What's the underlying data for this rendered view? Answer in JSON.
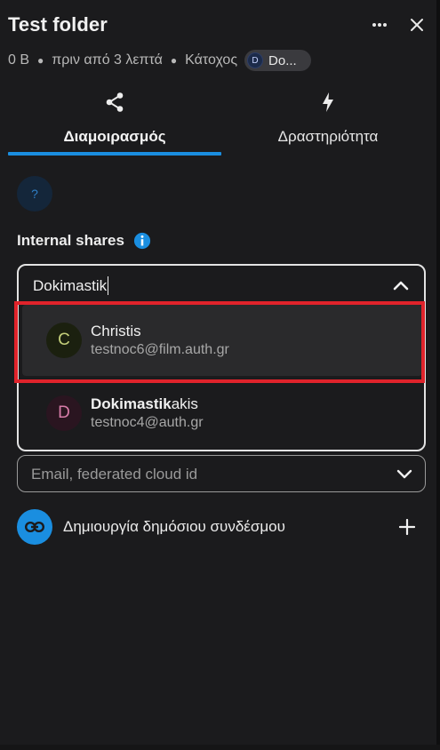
{
  "header": {
    "title": "Test folder",
    "size": "0 B",
    "modified": "πριν από 3 λεπτά",
    "owner_label": "Κάτοχος",
    "owner_initial": "D",
    "owner_name": "Do..."
  },
  "tabs": [
    {
      "label": "Διαμοιρασμός",
      "icon": "share-icon",
      "active": true
    },
    {
      "label": "Δραστηριότητα",
      "icon": "lightning-icon",
      "active": false
    }
  ],
  "help": {
    "symbol": "?"
  },
  "internal_shares": {
    "title": "Internal shares"
  },
  "search": {
    "value": "Dokimastik",
    "suggestions": [
      {
        "initial": "C",
        "name": "Christis",
        "email": "testnoc6@film.auth.gr"
      },
      {
        "initial": "D",
        "name_bold": "Dokimastik",
        "name_rest": "akis",
        "email": "testnoc4@auth.gr"
      }
    ]
  },
  "external": {
    "placeholder": "Email, federated cloud id"
  },
  "public_link": {
    "label": "Δημιουργία δημόσιου συνδέσμου"
  },
  "colors": {
    "accent": "#1a8ee0",
    "highlight": "#e0232b",
    "background": "#1b1b1d"
  }
}
